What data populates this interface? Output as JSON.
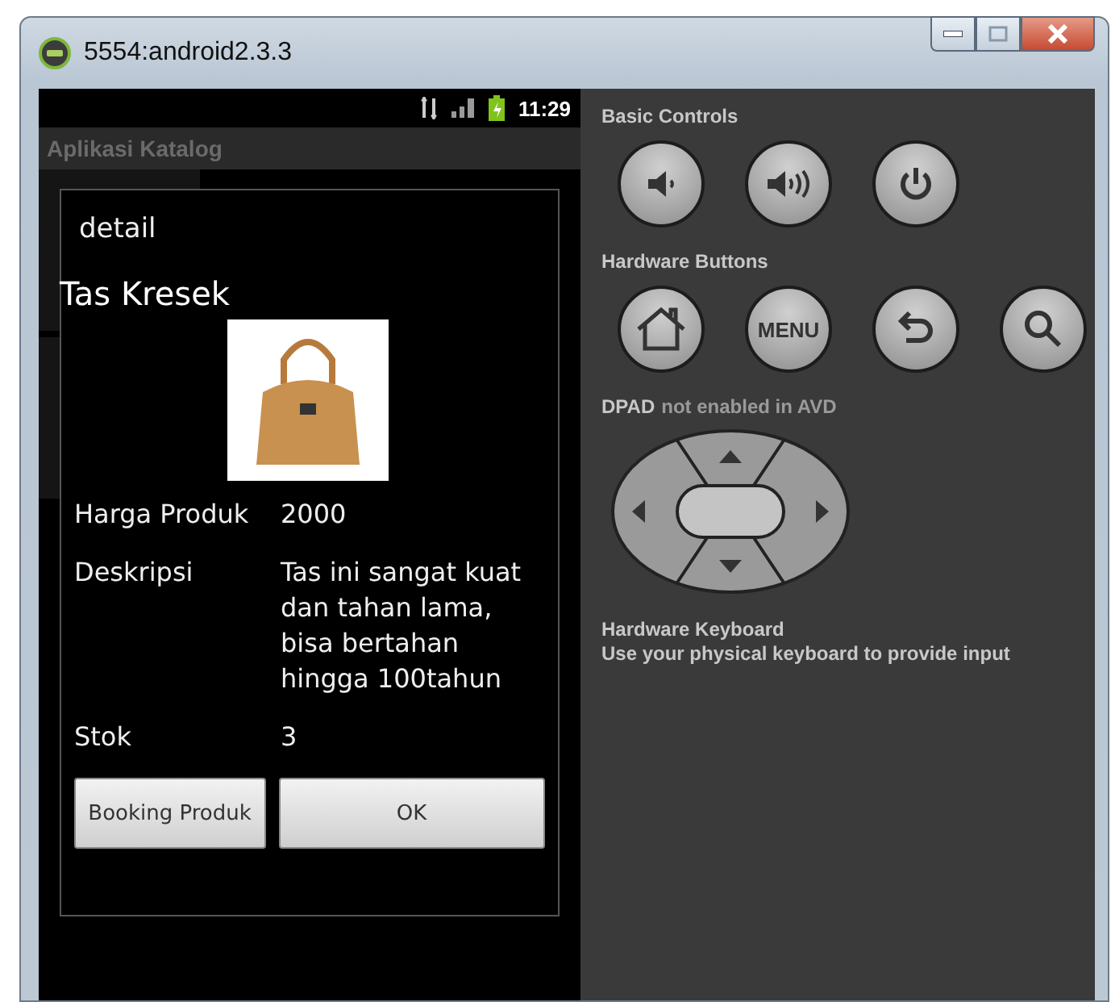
{
  "window": {
    "title": "5554:android2.3.3"
  },
  "status_bar": {
    "time": "11:29"
  },
  "app": {
    "title": "Aplikasi Katalog"
  },
  "dialog": {
    "title": "detail",
    "product_name": "Tas Kresek",
    "fields": [
      {
        "label": "Harga Produk",
        "value": "2000"
      },
      {
        "label": "Deskripsi",
        "value": "Tas ini sangat kuat dan tahan lama, bisa bertahan hingga 100tahun"
      },
      {
        "label": "Stok",
        "value": "3"
      }
    ],
    "buttons": [
      {
        "label": "Booking Produk",
        "kind": "narrow"
      },
      {
        "label": "OK",
        "kind": "wide"
      }
    ]
  },
  "controls": {
    "basic_title": "Basic Controls",
    "basic": [
      {
        "kind": "volume-down"
      },
      {
        "kind": "volume-up"
      },
      {
        "kind": "power"
      }
    ],
    "hardware_title": "Hardware Buttons",
    "hardware": [
      {
        "kind": "home"
      },
      {
        "kind": "menu",
        "label": "MENU"
      },
      {
        "kind": "back"
      },
      {
        "kind": "search"
      }
    ],
    "dpad": {
      "label": "DPAD",
      "note": "not enabled in AVD"
    },
    "keyboard": {
      "title": "Hardware Keyboard",
      "text": "Use your physical keyboard to provide input"
    }
  }
}
